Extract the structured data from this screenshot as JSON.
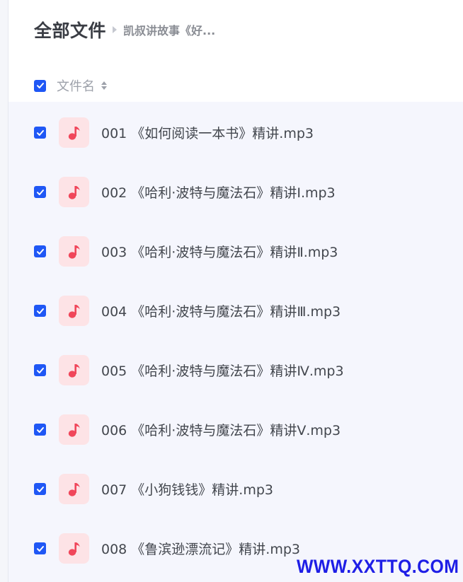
{
  "header": {
    "title": "全部文件",
    "breadcrumb": "凯叔讲故事《好..."
  },
  "table": {
    "column_name": "文件名",
    "sort_icon": "sort-icon",
    "select_all_checked": true
  },
  "files": [
    {
      "name": "001 《如何阅读一本书》精讲.mp3",
      "icon": "music-note-icon",
      "checked": true
    },
    {
      "name": "002 《哈利·波特与魔法石》精讲Ⅰ.mp3",
      "icon": "music-note-icon",
      "checked": true
    },
    {
      "name": "003 《哈利·波特与魔法石》精讲Ⅱ.mp3",
      "icon": "music-note-icon",
      "checked": true
    },
    {
      "name": "004 《哈利·波特与魔法石》精讲Ⅲ.mp3",
      "icon": "music-note-icon",
      "checked": true
    },
    {
      "name": "005 《哈利·波特与魔法石》精讲Ⅳ.mp3",
      "icon": "music-note-icon",
      "checked": true
    },
    {
      "name": "006 《哈利·波特与魔法石》精讲Ⅴ.mp3",
      "icon": "music-note-icon",
      "checked": true
    },
    {
      "name": "007 《小狗钱钱》精讲.mp3",
      "icon": "music-note-icon",
      "checked": true
    },
    {
      "name": "008 《鲁滨逊漂流记》精讲.mp3",
      "icon": "music-note-icon",
      "checked": true
    }
  ],
  "watermark": "WWW.XXTTQ.COM",
  "colors": {
    "accent": "#1f57f5",
    "icon_bg": "#fde3e6",
    "icon_fg": "#f0465a",
    "list_bg": "#f5f6fd",
    "watermark": "#1e1ee6"
  }
}
